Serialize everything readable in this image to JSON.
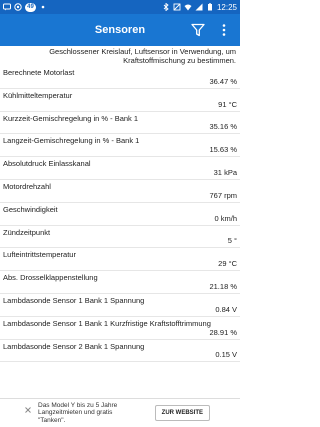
{
  "status_bar": {
    "notification_count": "49",
    "time": "12:25"
  },
  "app_bar": {
    "title": "Sensoren"
  },
  "status_message": "Geschlossener Kreislauf, Luftsensor in Verwendung, um Kraftstoffmischung zu bestimmen.",
  "sensors": [
    {
      "label": "Berechnete Motorlast",
      "value": "36.47 %"
    },
    {
      "label": "Kühlmitteltemperatur",
      "value": "91 °C"
    },
    {
      "label": "Kurzzeit-Gemischregelung in % - Bank 1",
      "value": "35.16 %"
    },
    {
      "label": "Langzeit-Gemischregelung in % - Bank 1",
      "value": "15.63 %"
    },
    {
      "label": "Absolutdruck Einlasskanal",
      "value": "31 kPa"
    },
    {
      "label": "Motordrehzahl",
      "value": "767 rpm"
    },
    {
      "label": "Geschwindigkeit",
      "value": "0 km/h"
    },
    {
      "label": "Zündzeitpunkt",
      "value": "5 °"
    },
    {
      "label": "Lufteintrittstemperatur",
      "value": "29 °C"
    },
    {
      "label": "Abs. Drosselklappenstellung",
      "value": "21.18 %"
    },
    {
      "label": "Lambdasonde Sensor 1 Bank 1 Spannung",
      "value": "0.84 V"
    },
    {
      "label": "Lambdasonde Sensor 1 Bank 1 Kurzfristige Kraftstofftrimmung",
      "value": "28.91 %"
    },
    {
      "label": "Lambdasonde Sensor 2 Bank 1 Spannung",
      "value": "0.15 V"
    }
  ],
  "ad": {
    "text": "Das Model Y bis zu 5 Jahre Langzeitmieten und gratis \"Tanken\".",
    "button_label": "ZUR WEBSITE"
  }
}
